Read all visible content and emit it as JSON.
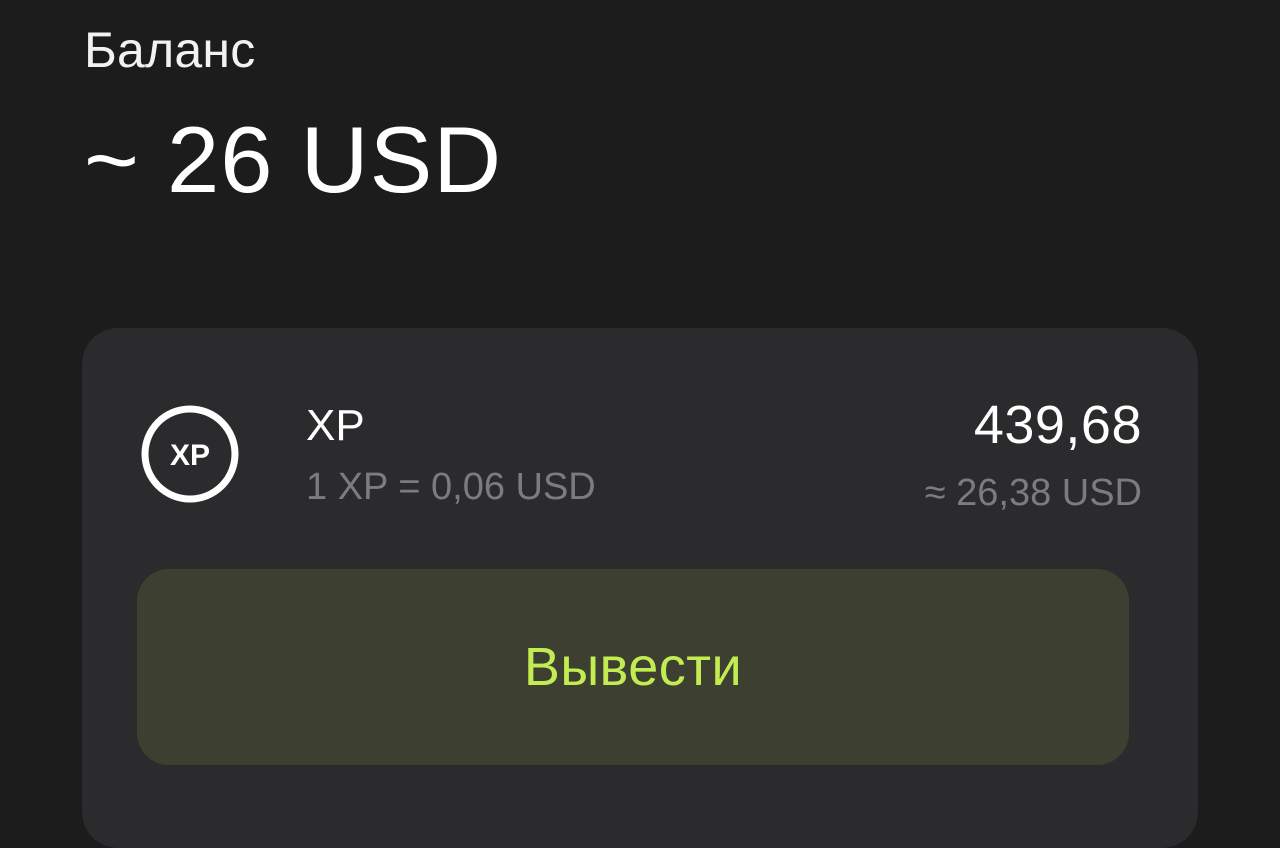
{
  "header": {
    "balance_label": "Баланс",
    "balance_amount": "~ 26 USD"
  },
  "asset": {
    "icon": "xp-token-icon",
    "icon_text": "XP",
    "name": "XP",
    "rate": "1 XP = 0,06 USD",
    "amount": "439,68",
    "amount_usd": "≈ 26,38 USD"
  },
  "actions": {
    "withdraw_label": "Вывести"
  },
  "colors": {
    "background": "#1c1c1c",
    "card": "#2b2b2d",
    "button_background": "#3d4030",
    "accent": "#c3ec52",
    "secondary_text": "#7c7c80"
  }
}
